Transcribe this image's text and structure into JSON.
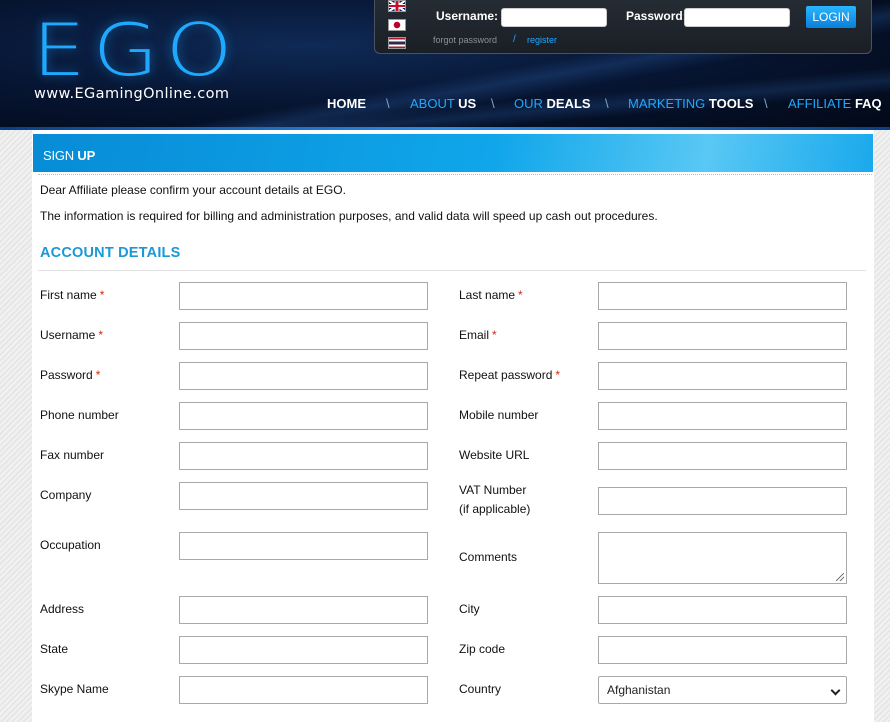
{
  "header": {
    "logo_text": "EGO",
    "logo_url": "www.EGamingOnline.com",
    "languages": [
      "english-flag",
      "japanese-flag",
      "thai-flag"
    ],
    "username_label": "Username:",
    "password_label": "Password:",
    "login_button": "LOGIN",
    "forgot_password": "forgot password",
    "separator": "/",
    "register": "register",
    "nav": [
      {
        "dim": "",
        "bright": "HOME"
      },
      {
        "dim": "ABOUT ",
        "bright": "US"
      },
      {
        "dim": "OUR ",
        "bright": "DEALS"
      },
      {
        "dim": "MARKETING ",
        "bright": "TOOLS"
      },
      {
        "dim": "AFFILIATE ",
        "bright": "FAQ"
      }
    ],
    "nav_separator": "\\"
  },
  "signup": {
    "title_light": "SIGN",
    "title_bold": "UP",
    "intro_1": "Dear Affiliate please confirm your account details at EGO.",
    "intro_2": "The information is required for billing and administration purposes, and valid data will speed up cash out procedures."
  },
  "account": {
    "title": "ACCOUNT DETAILS",
    "required_mark": "*",
    "fields": {
      "first_name": "First name",
      "last_name": "Last name",
      "username": "Username",
      "email": "Email",
      "password": "Password",
      "repeat_password": "Repeat password",
      "phone": "Phone number",
      "mobile": "Mobile number",
      "fax": "Fax number",
      "website": "Website URL",
      "company": "Company",
      "vat_line1": "VAT Number",
      "vat_line2": "(if applicable)",
      "occupation": "Occupation",
      "comments": "Comments",
      "address": "Address",
      "city": "City",
      "state": "State",
      "zip": "Zip code",
      "skype": "Skype Name",
      "country": "Country"
    },
    "country_selected": "Afghanistan"
  },
  "colors": {
    "accent": "#1ea9ff",
    "section_title": "#1a98d8",
    "required": "#dd2211"
  }
}
